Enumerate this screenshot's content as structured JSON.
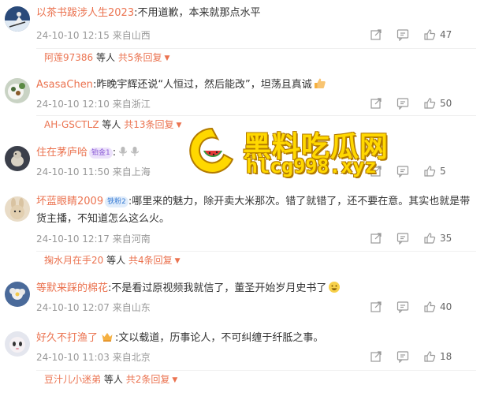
{
  "accent_color": "#eb7350",
  "watermark": {
    "title": "黑料吃瓜网",
    "url": "hlcg998.xyz",
    "logo": "watermelon-logo"
  },
  "comments": [
    {
      "username": "以茶书跋涉人生2023",
      "text": ":不用道歉，本来就那点水平",
      "date": "24-10-10 12:15",
      "location": "来自山西",
      "likes": "47",
      "avatar": "skier-avatar",
      "replies": {
        "name": "阿莲97386",
        "mid": "等人",
        "count": "共5条回复"
      }
    },
    {
      "username": "AsasaChen",
      "text": ":昨晚宇辉还说“人恒过，然后能改”，坦荡且真诚",
      "emoji": "thumbs-up-emoji",
      "date": "24-10-10 12:10",
      "location": "来自浙江",
      "likes": "50",
      "avatar": "plate-avatar",
      "replies": {
        "name": "AH-GSCTLZ",
        "mid": "等人",
        "count": "共13条回复"
      }
    },
    {
      "username": "住在茅庐哈",
      "badge": "铂金1",
      "text": ":",
      "date": "24-10-10 11:50",
      "location": "来自上海",
      "likes": "5",
      "avatar": "bird-avatar"
    },
    {
      "username": "坏蓝眼睛2009",
      "badge": "铁粉2",
      "text": ":哪里来的魅力，除开卖大米那次。错了就错了，还不要在意。其实也就是带货主播，不知道怎么这么火。",
      "date": "24-10-10 12:17",
      "location": "来自河南",
      "likes": "35",
      "avatar": "rabbit-avatar",
      "replies": {
        "name": "掬水月在手20",
        "mid": "等人",
        "count": "共4条回复"
      }
    },
    {
      "username": "等默来踩的棉花",
      "text": ":不是看过原视频我就信了，董圣开始岁月史书了",
      "emoji": "grin-emoji",
      "date": "24-10-10 12:07",
      "location": "来自山东",
      "likes": "40",
      "avatar": "flower-avatar"
    },
    {
      "username": "好久不打渔了",
      "text": ":文以载道，历事论人，不可纠缠于纤胝之事。",
      "date": "24-10-10 11:03",
      "location": "来自北京",
      "likes": "18",
      "avatar": "cartoon-avatar",
      "crown": "crown-emoji",
      "replies": {
        "name": "豆汁儿小迷弟",
        "mid": "等人",
        "count": "共2条回复"
      }
    }
  ]
}
